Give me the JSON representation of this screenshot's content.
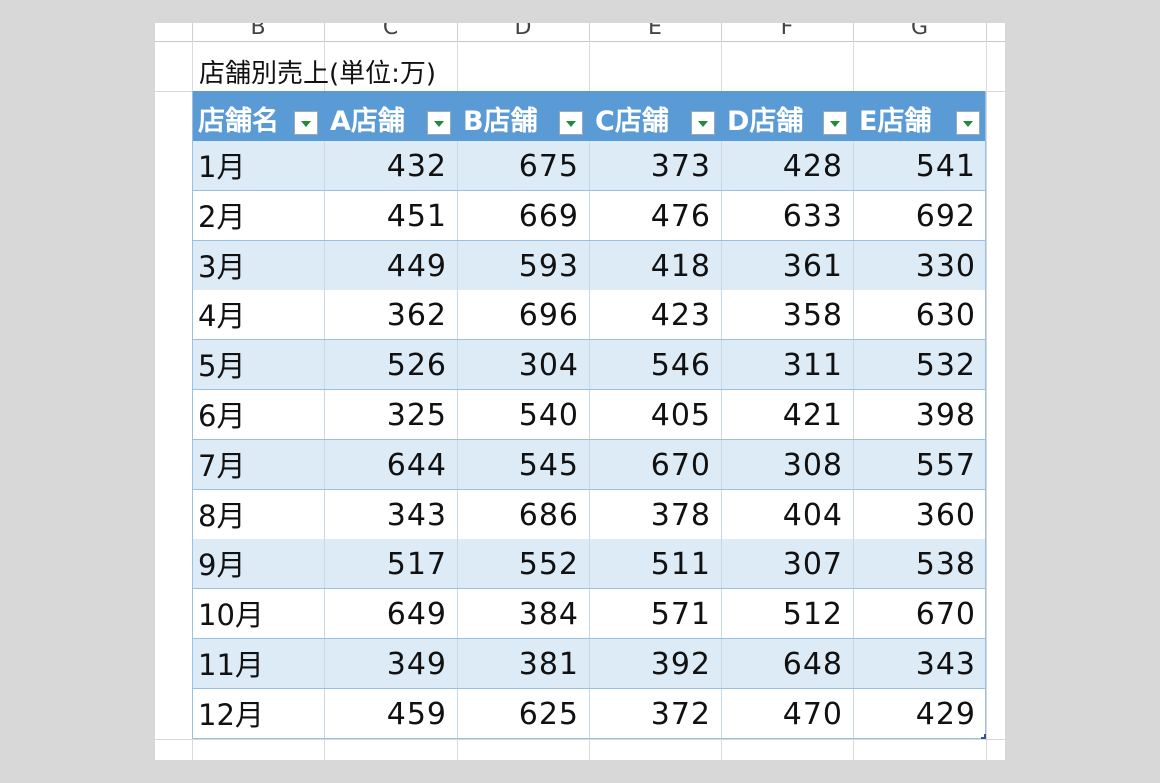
{
  "column_headers": [
    "B",
    "C",
    "D",
    "E",
    "F",
    "G"
  ],
  "title": "店舗別売上(単位:万)",
  "table": {
    "headers": [
      "店舗名",
      "A店舗",
      "B店舗",
      "C店舗",
      "D店舗",
      "E店舗"
    ],
    "rows": [
      {
        "month": "1月",
        "values": [
          "432",
          "675",
          "373",
          "428",
          "541"
        ]
      },
      {
        "month": "2月",
        "values": [
          "451",
          "669",
          "476",
          "633",
          "692"
        ]
      },
      {
        "month": "3月",
        "values": [
          "449",
          "593",
          "418",
          "361",
          "330"
        ]
      },
      {
        "month": "4月",
        "values": [
          "362",
          "696",
          "423",
          "358",
          "630"
        ]
      },
      {
        "month": "5月",
        "values": [
          "526",
          "304",
          "546",
          "311",
          "532"
        ]
      },
      {
        "month": "6月",
        "values": [
          "325",
          "540",
          "405",
          "421",
          "398"
        ]
      },
      {
        "month": "7月",
        "values": [
          "644",
          "545",
          "670",
          "308",
          "557"
        ]
      },
      {
        "month": "8月",
        "values": [
          "343",
          "686",
          "378",
          "404",
          "360"
        ]
      },
      {
        "month": "9月",
        "values": [
          "517",
          "552",
          "511",
          "307",
          "538"
        ]
      },
      {
        "month": "10月",
        "values": [
          "649",
          "384",
          "571",
          "512",
          "670"
        ]
      },
      {
        "month": "11月",
        "values": [
          "349",
          "381",
          "392",
          "648",
          "343"
        ]
      },
      {
        "month": "12月",
        "values": [
          "459",
          "625",
          "372",
          "470",
          "429"
        ]
      }
    ]
  },
  "colors": {
    "header_bg": "#5b9bd5",
    "band_bg": "#ddebf7",
    "filter_arrow": "#1e8c3a"
  },
  "icons": {
    "filter": "filter-dropdown-icon"
  }
}
